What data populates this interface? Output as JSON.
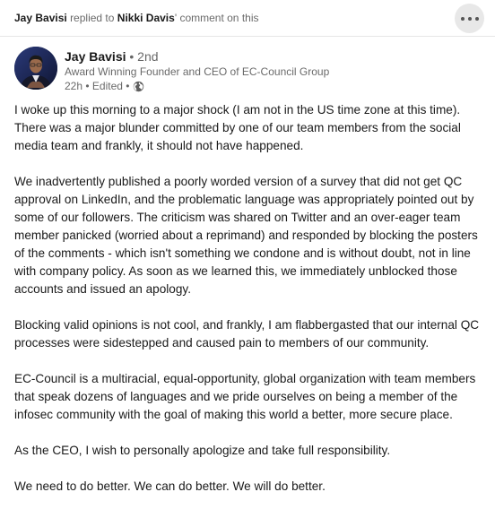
{
  "context": {
    "actor": "Jay Bavisi",
    "action": "replied to",
    "target": "Nikki Davis",
    "suffix": "' comment on this"
  },
  "more_button": {
    "icon": "more-horizontal-icon"
  },
  "author": {
    "name": "Jay Bavisi",
    "degree": "• 2nd",
    "headline": "Award Winning Founder and CEO of EC-Council Group",
    "meta": "22h • Edited •",
    "visibility_icon": "globe-icon"
  },
  "post": {
    "paragraphs": [
      "I woke up this morning to a major shock (I am not in the US time zone at this time). There was a major blunder committed by one of our team members from the social media team and frankly, it should not have happened.",
      "We inadvertently published a poorly worded version of a survey that did not get QC approval on LinkedIn, and the problematic language was appropriately pointed out by some of our followers. The criticism was shared on Twitter and an over-eager team member panicked (worried about a reprimand) and responded by blocking the posters of the comments - which isn't something we condone and is without doubt, not in line with company policy. As soon as we learned this, we immediately unblocked those accounts and issued an apology.",
      "Blocking valid opinions is not cool, and frankly, I am flabbergasted that our internal QC processes were sidestepped and caused pain to members of our community.",
      "EC-Council is a multiracial, equal-opportunity, global organization with team members that speak dozens of languages and we pride ourselves on being a member of the infosec community with the goal of making this world a better, more secure place.",
      "As the CEO, I wish to personally apologize and take full responsibility.",
      "We need to do better. We can do better. We will do better."
    ]
  }
}
